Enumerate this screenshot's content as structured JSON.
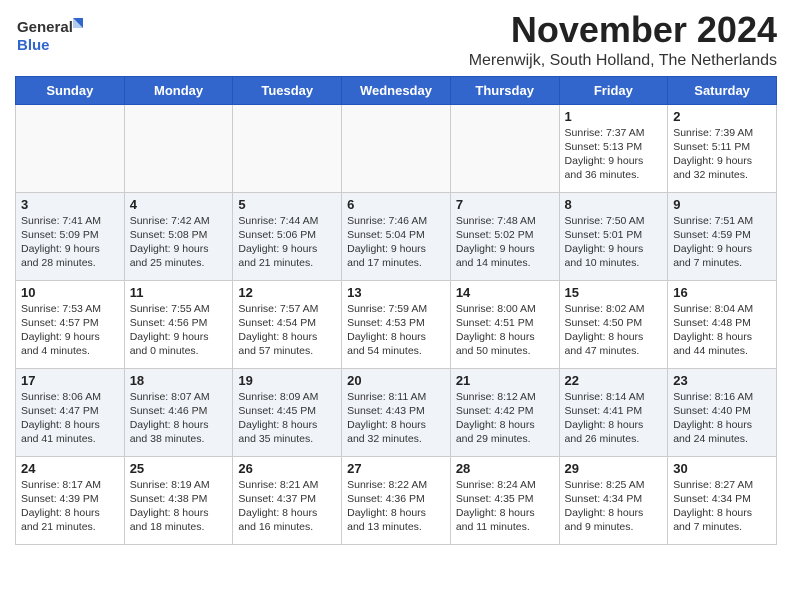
{
  "logo": {
    "line1": "General",
    "line2": "Blue"
  },
  "title": "November 2024",
  "subtitle": "Merenwijk, South Holland, The Netherlands",
  "headers": [
    "Sunday",
    "Monday",
    "Tuesday",
    "Wednesday",
    "Thursday",
    "Friday",
    "Saturday"
  ],
  "weeks": [
    [
      {
        "day": "",
        "info": ""
      },
      {
        "day": "",
        "info": ""
      },
      {
        "day": "",
        "info": ""
      },
      {
        "day": "",
        "info": ""
      },
      {
        "day": "",
        "info": ""
      },
      {
        "day": "1",
        "info": "Sunrise: 7:37 AM\nSunset: 5:13 PM\nDaylight: 9 hours\nand 36 minutes."
      },
      {
        "day": "2",
        "info": "Sunrise: 7:39 AM\nSunset: 5:11 PM\nDaylight: 9 hours\nand 32 minutes."
      }
    ],
    [
      {
        "day": "3",
        "info": "Sunrise: 7:41 AM\nSunset: 5:09 PM\nDaylight: 9 hours\nand 28 minutes."
      },
      {
        "day": "4",
        "info": "Sunrise: 7:42 AM\nSunset: 5:08 PM\nDaylight: 9 hours\nand 25 minutes."
      },
      {
        "day": "5",
        "info": "Sunrise: 7:44 AM\nSunset: 5:06 PM\nDaylight: 9 hours\nand 21 minutes."
      },
      {
        "day": "6",
        "info": "Sunrise: 7:46 AM\nSunset: 5:04 PM\nDaylight: 9 hours\nand 17 minutes."
      },
      {
        "day": "7",
        "info": "Sunrise: 7:48 AM\nSunset: 5:02 PM\nDaylight: 9 hours\nand 14 minutes."
      },
      {
        "day": "8",
        "info": "Sunrise: 7:50 AM\nSunset: 5:01 PM\nDaylight: 9 hours\nand 10 minutes."
      },
      {
        "day": "9",
        "info": "Sunrise: 7:51 AM\nSunset: 4:59 PM\nDaylight: 9 hours\nand 7 minutes."
      }
    ],
    [
      {
        "day": "10",
        "info": "Sunrise: 7:53 AM\nSunset: 4:57 PM\nDaylight: 9 hours\nand 4 minutes."
      },
      {
        "day": "11",
        "info": "Sunrise: 7:55 AM\nSunset: 4:56 PM\nDaylight: 9 hours\nand 0 minutes."
      },
      {
        "day": "12",
        "info": "Sunrise: 7:57 AM\nSunset: 4:54 PM\nDaylight: 8 hours\nand 57 minutes."
      },
      {
        "day": "13",
        "info": "Sunrise: 7:59 AM\nSunset: 4:53 PM\nDaylight: 8 hours\nand 54 minutes."
      },
      {
        "day": "14",
        "info": "Sunrise: 8:00 AM\nSunset: 4:51 PM\nDaylight: 8 hours\nand 50 minutes."
      },
      {
        "day": "15",
        "info": "Sunrise: 8:02 AM\nSunset: 4:50 PM\nDaylight: 8 hours\nand 47 minutes."
      },
      {
        "day": "16",
        "info": "Sunrise: 8:04 AM\nSunset: 4:48 PM\nDaylight: 8 hours\nand 44 minutes."
      }
    ],
    [
      {
        "day": "17",
        "info": "Sunrise: 8:06 AM\nSunset: 4:47 PM\nDaylight: 8 hours\nand 41 minutes."
      },
      {
        "day": "18",
        "info": "Sunrise: 8:07 AM\nSunset: 4:46 PM\nDaylight: 8 hours\nand 38 minutes."
      },
      {
        "day": "19",
        "info": "Sunrise: 8:09 AM\nSunset: 4:45 PM\nDaylight: 8 hours\nand 35 minutes."
      },
      {
        "day": "20",
        "info": "Sunrise: 8:11 AM\nSunset: 4:43 PM\nDaylight: 8 hours\nand 32 minutes."
      },
      {
        "day": "21",
        "info": "Sunrise: 8:12 AM\nSunset: 4:42 PM\nDaylight: 8 hours\nand 29 minutes."
      },
      {
        "day": "22",
        "info": "Sunrise: 8:14 AM\nSunset: 4:41 PM\nDaylight: 8 hours\nand 26 minutes."
      },
      {
        "day": "23",
        "info": "Sunrise: 8:16 AM\nSunset: 4:40 PM\nDaylight: 8 hours\nand 24 minutes."
      }
    ],
    [
      {
        "day": "24",
        "info": "Sunrise: 8:17 AM\nSunset: 4:39 PM\nDaylight: 8 hours\nand 21 minutes."
      },
      {
        "day": "25",
        "info": "Sunrise: 8:19 AM\nSunset: 4:38 PM\nDaylight: 8 hours\nand 18 minutes."
      },
      {
        "day": "26",
        "info": "Sunrise: 8:21 AM\nSunset: 4:37 PM\nDaylight: 8 hours\nand 16 minutes."
      },
      {
        "day": "27",
        "info": "Sunrise: 8:22 AM\nSunset: 4:36 PM\nDaylight: 8 hours\nand 13 minutes."
      },
      {
        "day": "28",
        "info": "Sunrise: 8:24 AM\nSunset: 4:35 PM\nDaylight: 8 hours\nand 11 minutes."
      },
      {
        "day": "29",
        "info": "Sunrise: 8:25 AM\nSunset: 4:34 PM\nDaylight: 8 hours\nand 9 minutes."
      },
      {
        "day": "30",
        "info": "Sunrise: 8:27 AM\nSunset: 4:34 PM\nDaylight: 8 hours\nand 7 minutes."
      }
    ]
  ]
}
